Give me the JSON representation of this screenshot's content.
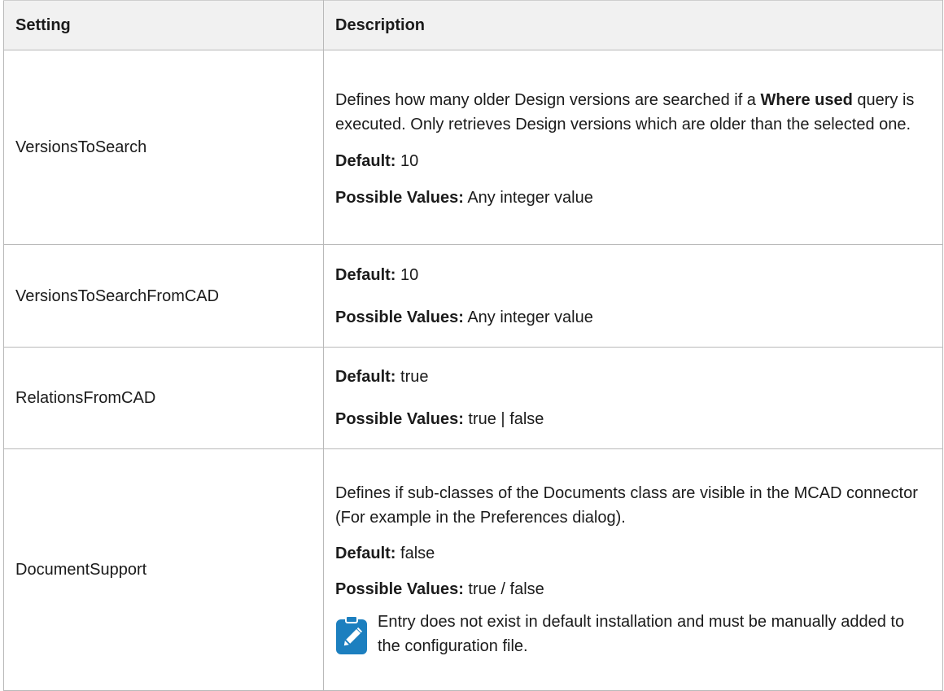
{
  "table": {
    "headers": {
      "setting": "Setting",
      "description": "Description"
    },
    "rows": [
      {
        "name": "VersionsToSearch",
        "desc_pre": "Defines how many older Design versions are searched if a ",
        "desc_bold": "Where used",
        "desc_post": " query is executed. Only retrieves Design versions which are older than the selected one.",
        "default_label": "Default:",
        "default_value": " 10",
        "possible_label": "Possible Values:",
        "possible_value": " Any integer value"
      },
      {
        "name": "VersionsToSearchFromCAD",
        "default_label": "Default:",
        "default_value": " 10",
        "possible_label": "Possible Values:",
        "possible_value": " Any integer value"
      },
      {
        "name": "RelationsFromCAD",
        "default_label": "Default:",
        "default_value": " true",
        "possible_label": "Possible Values:",
        "possible_value": " true | false"
      },
      {
        "name": "DocumentSupport",
        "description": "Defines if sub-classes of the Documents class are visible in the MCAD connector (For example in the Preferences dialog).",
        "default_label": "Default:",
        "default_value": " false",
        "possible_label": "Possible Values:",
        "possible_value": " true / false",
        "note": "Entry does not exist in default installation and must be manually added to the configuration file.",
        "note_icon": "pencil-note-icon"
      }
    ]
  },
  "colors": {
    "header_bg": "#f1f1f1",
    "border": "#b9b9b9",
    "note_icon": "#1c7fbf"
  }
}
